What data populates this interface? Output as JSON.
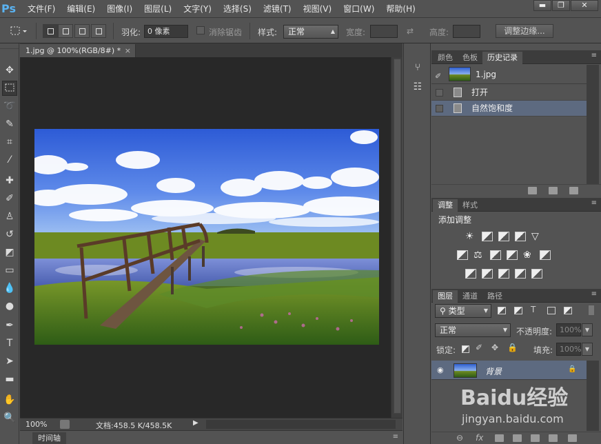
{
  "app": {
    "logo": "Ps"
  },
  "menu": [
    "文件(F)",
    "编辑(E)",
    "图像(I)",
    "图层(L)",
    "文字(Y)",
    "选择(S)",
    "滤镜(T)",
    "视图(V)",
    "窗口(W)",
    "帮助(H)"
  ],
  "window_buttons": [
    "▬",
    "❐",
    "✕"
  ],
  "options": {
    "feather_label": "羽化:",
    "feather_value": "0 像素",
    "antialias_label": "消除锯齿",
    "style_label": "样式:",
    "style_value": "正常",
    "width_label": "宽度:",
    "height_label": "高度:",
    "refine_edge_button": "调整边缘..."
  },
  "document": {
    "tab_title": "1.jpg @ 100%(RGB/8#) *",
    "tab_close": "×",
    "zoom": "100%",
    "doc_info": "文档:458.5 K/458.5K"
  },
  "timeline": {
    "tab": "时间轴"
  },
  "tools": [
    "move-tool",
    "marquee-tool",
    "lasso-tool",
    "quick-select-tool",
    "crop-tool",
    "eyedropper-tool",
    "healing-brush-tool",
    "brush-tool",
    "clone-stamp-tool",
    "history-brush-tool",
    "eraser-tool",
    "gradient-tool",
    "blur-tool",
    "dodge-tool",
    "pen-tool",
    "type-tool",
    "path-select-tool",
    "shape-tool",
    "hand-tool",
    "zoom-tool"
  ],
  "history_panel": {
    "tabs": [
      "颜色",
      "色板",
      "历史记录"
    ],
    "snapshot_name": "1.jpg",
    "items": [
      {
        "label": "打开",
        "selected": false
      },
      {
        "label": "自然饱和度",
        "selected": true
      }
    ]
  },
  "adjustments_panel": {
    "tabs": [
      "调整",
      "样式"
    ],
    "title": "添加调整"
  },
  "layers_panel": {
    "tabs": [
      "图层",
      "通道",
      "路径"
    ],
    "filter_kind": "类型",
    "blend_mode": "正常",
    "opacity_label": "不透明度:",
    "opacity_value": "100%",
    "lock_label": "锁定:",
    "fill_label": "填充:",
    "fill_value": "100%",
    "layer_name": "背景"
  },
  "watermark": {
    "brand": "Baidu经验",
    "url": "jingyan.baidu.com"
  },
  "colors": {
    "accent_select": "#5d6a80",
    "ps_blue": "#5ab3f2",
    "ui_gray": "#535353"
  }
}
